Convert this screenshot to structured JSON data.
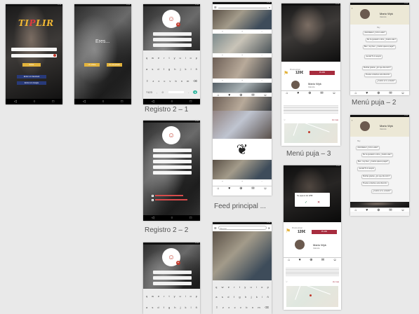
{
  "captions": {
    "registro_2_1": "Registro  2 – 1",
    "registro_2_2": "Registro  2 – 2",
    "feed_principal": "Feed principal ...",
    "menu_puja_3": "Menú puja – 3",
    "menu_puja_2": "Menú puja – 2"
  },
  "status_time": "12:30",
  "login": {
    "logo_left": "TI",
    "logo_mid": "P",
    "logo_right": "LIR",
    "primary_button": "Entrar",
    "facebook_button": "Entrar con facebook",
    "google_button": "Entrar con Google"
  },
  "eres": {
    "question": "Eres...",
    "option_left": "Un artista",
    "option_right": "Un comprador"
  },
  "feed": {
    "search_placeholder": "Buscar"
  },
  "puja": {
    "price": "120€",
    "price_label": "Precio actual",
    "bid_button": "PUJAR",
    "user_name": "Mario Wyk",
    "user_location": "Valencia",
    "action_bar": "Ver más",
    "modal_text": "Su puja es de 125€"
  },
  "chat": {
    "user_name": "Mario Wyk",
    "user_location": "Valencia",
    "day_label": "Hoy",
    "messages": [
      "¡Felicidades! ¿Cómo estás?",
      "Me he gustado tu obra, ¿Cuánto vale?",
      "Bien, muy bien, ¿Cuánto quieres pagar?",
      "¡Genial! Te lo acepto",
      "Muchas gracias, ¿En que dirección?",
      "Puedes enviarla a esta dirección",
      "¿Cuánto te he enviado?"
    ]
  },
  "colors": {
    "accent_yellow": "#e3b33c",
    "facebook_blue": "#283a7a",
    "bid_red": "#a72c3e",
    "logo_red": "#e03a3e"
  }
}
